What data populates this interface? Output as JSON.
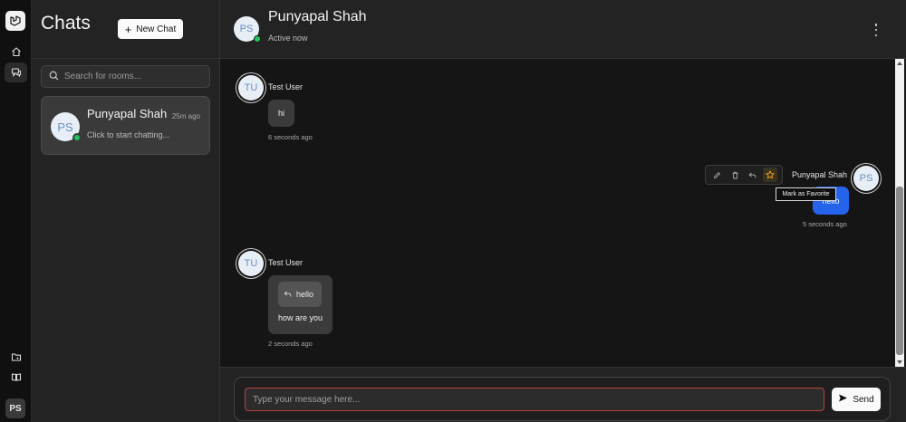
{
  "sidebar": {
    "logo_icon": "laravel-logo-icon",
    "nav": [
      {
        "icon": "home-icon",
        "active": false
      },
      {
        "icon": "chat-bubbles-icon",
        "active": true
      }
    ],
    "bottom": [
      {
        "icon": "folder-git-icon"
      },
      {
        "icon": "book-open-icon"
      }
    ],
    "user_initials": "PS"
  },
  "chat_list": {
    "title": "Chats",
    "new_chat_label": "New Chat",
    "search_placeholder": "Search for rooms...",
    "rooms": [
      {
        "initials": "PS",
        "name": "Punyapal Shah",
        "time": "25m ago",
        "preview": "Click to start chatting...",
        "online": true
      }
    ]
  },
  "header": {
    "initials": "PS",
    "name": "Punyapal Shah",
    "status": "Active now"
  },
  "messages": [
    {
      "sender": "Test User",
      "initials": "TU",
      "text": "hi",
      "time": "6 seconds ago",
      "own": false
    },
    {
      "sender": "Punyapal Shah",
      "initials": "PS",
      "text": "hello",
      "time": "5 seconds ago",
      "own": true
    },
    {
      "sender": "Test User",
      "initials": "TU",
      "reply_to": "hello",
      "text": "how are you",
      "time": "2 seconds ago",
      "own": false
    }
  ],
  "message_toolbar": {
    "actions": [
      "edit-icon",
      "delete-icon",
      "reply-icon",
      "star-icon"
    ],
    "tooltip": "Mark as Favorite"
  },
  "composer": {
    "placeholder": "Type your message here...",
    "send_label": "Send"
  },
  "colors": {
    "accent": "#2563eb",
    "online": "#22c55e",
    "favorite": "#f5a623",
    "input_border": "#b54242"
  }
}
